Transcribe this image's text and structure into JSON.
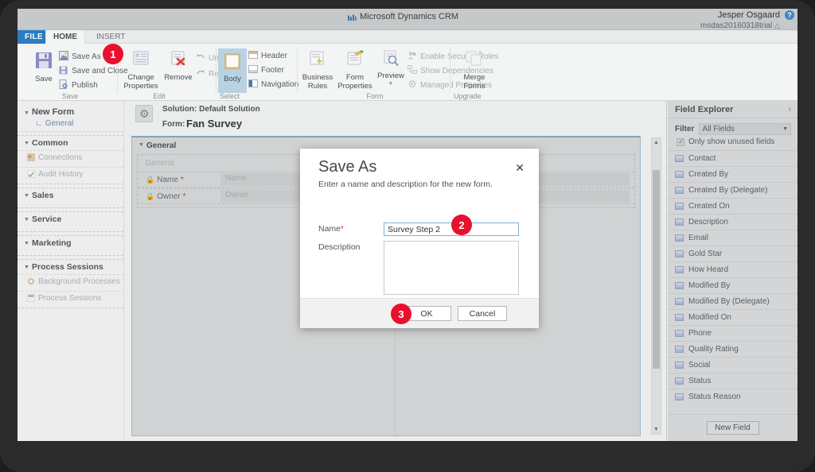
{
  "app": {
    "brand": "Microsoft Dynamics CRM",
    "brand_logo_icon": "dynamics-logo-icon",
    "user_name": "Jesper Osgaard",
    "user_org": "msdas20160318trial",
    "help_icon": "help-icon",
    "home_icon": "home-icon"
  },
  "tabs": [
    {
      "label": "FILE",
      "name": "tab-file"
    },
    {
      "label": "HOME",
      "name": "tab-home"
    },
    {
      "label": "INSERT",
      "name": "tab-insert"
    }
  ],
  "ribbon": {
    "groups": [
      {
        "label": "Save",
        "big": {
          "label": "Save",
          "icon": "floppy-disk-icon"
        },
        "items": [
          {
            "label": "Save As",
            "icon": "save-as-icon"
          },
          {
            "label": "Save and Close",
            "icon": "save-and-close-icon"
          },
          {
            "label": "Publish",
            "icon": "publish-icon"
          }
        ]
      },
      {
        "label": "Edit",
        "big": [
          {
            "label": "Change\nProperties",
            "icon": "change-properties-icon"
          },
          {
            "label": "Remove",
            "icon": "remove-icon"
          }
        ],
        "items": [
          {
            "label": "Undo",
            "icon": "undo-icon"
          },
          {
            "label": "Redo",
            "icon": "redo-icon"
          }
        ]
      },
      {
        "label": "Select",
        "big": {
          "label": "Body",
          "icon": "body-icon"
        },
        "items": [
          {
            "label": "Header",
            "icon": "header-icon"
          },
          {
            "label": "Footer",
            "icon": "footer-icon"
          },
          {
            "label": "Navigation",
            "icon": "navigation-icon"
          }
        ]
      },
      {
        "label": "Form",
        "big": [
          {
            "label": "Business\nRules",
            "icon": "business-rules-icon"
          },
          {
            "label": "Form\nProperties",
            "icon": "form-properties-icon"
          },
          {
            "label": "Preview",
            "icon": "preview-icon"
          }
        ],
        "items": [
          {
            "label": "Enable Security Roles",
            "icon": "security-roles-icon"
          },
          {
            "label": "Show Dependencies",
            "icon": "dependencies-icon"
          },
          {
            "label": "Managed Properties",
            "icon": "managed-properties-icon"
          }
        ]
      },
      {
        "label": "Upgrade",
        "big": {
          "label": "Merge\nForms",
          "icon": "merge-forms-icon"
        },
        "items": []
      }
    ]
  },
  "leftnav": {
    "title": "New Form",
    "sub": "General",
    "sub_prefix": "L",
    "sections": [
      {
        "header": "Common",
        "items": [
          {
            "label": "Connections",
            "icon": "connections-icon"
          },
          {
            "label": "Audit History",
            "icon": "audit-history-icon"
          }
        ]
      },
      {
        "header": "Sales",
        "items": []
      },
      {
        "header": "Service",
        "items": []
      },
      {
        "header": "Marketing",
        "items": []
      },
      {
        "header": "Process Sessions",
        "items": [
          {
            "label": "Background Processes",
            "icon": "background-processes-icon"
          },
          {
            "label": "Process Sessions",
            "icon": "process-sessions-icon"
          }
        ]
      }
    ]
  },
  "canvas": {
    "solution_text": "Solution: Default Solution",
    "form_label": "Form:",
    "form_name": "Fan Survey",
    "tab_header": "General",
    "section_name": "General",
    "rows": [
      {
        "label": "Name",
        "required": "*",
        "value": "Name",
        "locked": true
      },
      {
        "label": "Owner",
        "required": "*",
        "value": "Owner",
        "locked": true
      }
    ]
  },
  "field_explorer": {
    "title": "Field Explorer",
    "expand_icon": "chevron-right-icon",
    "filter_label": "Filter",
    "filter_value": "All Fields",
    "checkbox_label": "Only show unused fields",
    "checkbox_checked": true,
    "fields": [
      "Contact",
      "Created By",
      "Created By (Delegate)",
      "Created On",
      "Description",
      "Email",
      "Gold Star",
      "How Heard",
      "Modified By",
      "Modified By (Delegate)",
      "Modified On",
      "Phone",
      "Quality Rating",
      "Social",
      "Status",
      "Status Reason"
    ],
    "new_field_button": "New Field"
  },
  "dialog": {
    "title": "Save As",
    "subtitle": "Enter a name and description for the new form.",
    "close_icon": "close-icon",
    "name_label": "Name",
    "name_required": "*",
    "name_value": "Survey Step 2",
    "description_label": "Description",
    "description_value": "",
    "ok_label": "OK",
    "cancel_label": "Cancel"
  },
  "callouts": [
    {
      "number": "1"
    },
    {
      "number": "2"
    },
    {
      "number": "3"
    }
  ],
  "colors": {
    "accent_blue": "#2c7cc0",
    "callout_red": "#e8112d",
    "frame_dark": "#2b2b2b",
    "required_red": "#d13b3b"
  }
}
